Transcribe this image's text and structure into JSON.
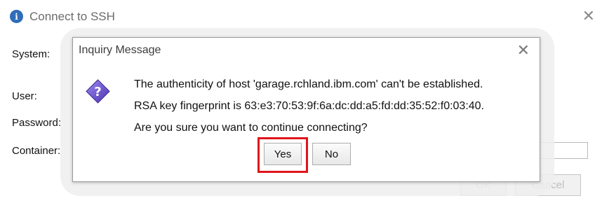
{
  "background_window": {
    "title": "Connect to SSH",
    "labels": {
      "system": "System:",
      "user": "User:",
      "password": "Password:",
      "container": "Container:"
    },
    "ok_label": "OK",
    "cancel_label": "Cancel"
  },
  "dialog": {
    "title": "Inquiry Message",
    "message_lines": [
      "The authenticity of host 'garage.rchland.ibm.com' can't be established.",
      "RSA key fingerprint is 63:e3:70:53:9f:6a:dc:dd:a5:fd:dd:35:52:f0:03:40.",
      "Are you sure you want to continue connecting?"
    ],
    "yes_label": "Yes",
    "no_label": "No",
    "icon": "question-icon"
  },
  "colors": {
    "highlight": "#e0141b",
    "icon_purple": "#6a4ec8"
  }
}
